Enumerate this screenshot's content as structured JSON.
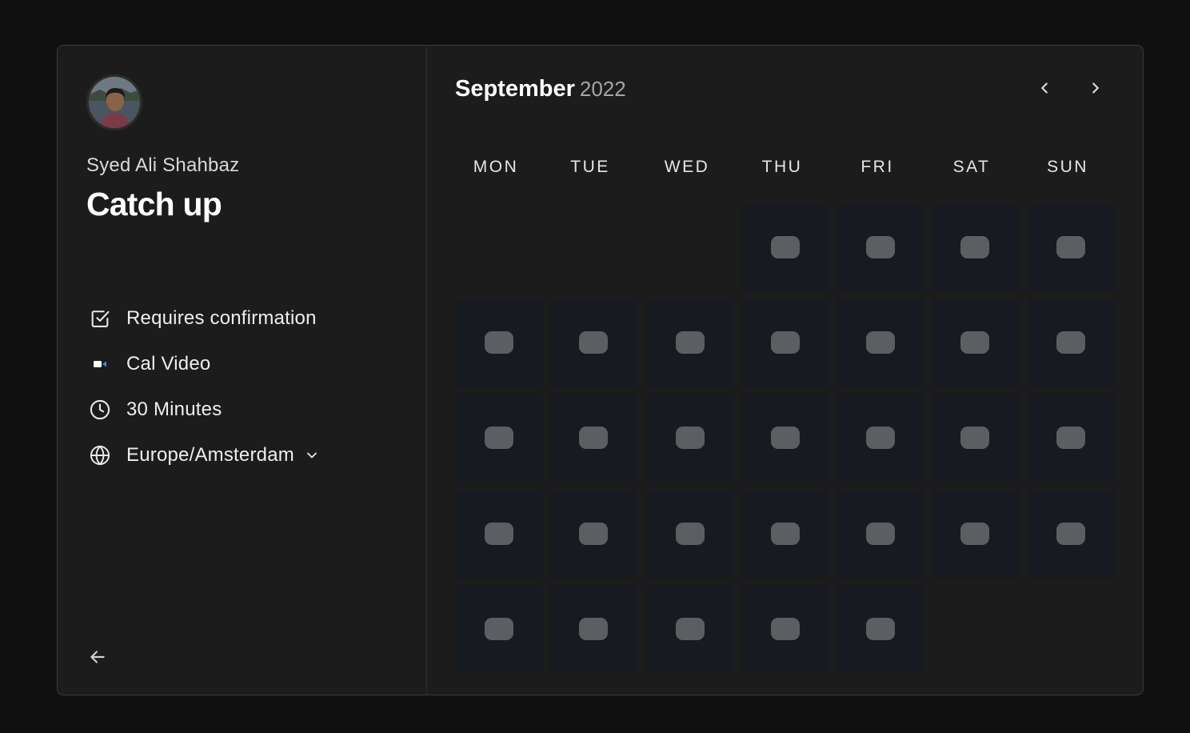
{
  "profile": {
    "organizer_name": "Syed Ali Shahbaz",
    "avatar_alt": "Syed Ali Shahbaz"
  },
  "event": {
    "title": "Catch up",
    "details": [
      {
        "icon": "checkbox-icon",
        "label": "Requires confirmation"
      },
      {
        "icon": "video-icon",
        "label": "Cal Video"
      },
      {
        "icon": "clock-icon",
        "label": "30 Minutes"
      },
      {
        "icon": "globe-icon",
        "label": "Europe/Amsterdam"
      }
    ],
    "timezone_selected": "Europe/Amsterdam"
  },
  "calendar": {
    "month": "September",
    "year": "2022",
    "weekdays": [
      "MON",
      "TUE",
      "WED",
      "THU",
      "FRI",
      "SAT",
      "SUN"
    ],
    "first_weekday_index": 3,
    "days_in_month": 30,
    "day_state": "loading-placeholder"
  },
  "colors": {
    "background": "#101010",
    "card": "#1c1c1c",
    "day_cell": "#181a22",
    "placeholder": "#5d5e61",
    "muted_text": "#a6a6a6"
  }
}
